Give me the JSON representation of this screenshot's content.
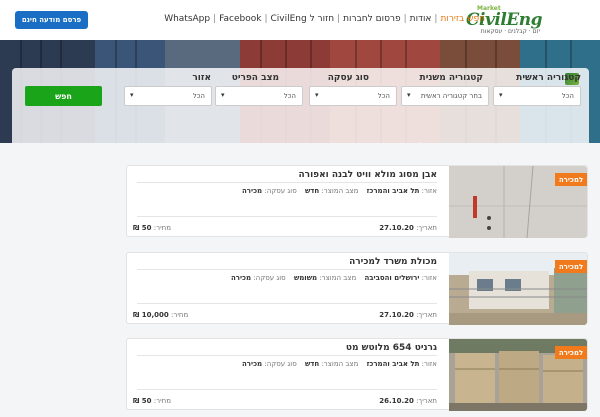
{
  "header": {
    "logo_market": "Market",
    "logo_brand": "CivilEng",
    "logo_tagline": "יזם · קבלנים · עסקאות",
    "nav": [
      "חפש בזירות",
      "אודות",
      "פרסום לחברות",
      "חזור ל CivilEng",
      "Facebook",
      "WhatsApp"
    ],
    "post_button": "פרסם מודעה חינם"
  },
  "search": {
    "fields": [
      {
        "label": "קטגוריה ראשית",
        "value": "הכל"
      },
      {
        "label": "קטגוריה משנית",
        "value": "בחר קטגוריה ראשית"
      },
      {
        "label": "סוג עסקה",
        "value": "הכל"
      },
      {
        "label": "מצב הפריט",
        "value": "הכל"
      },
      {
        "label": "אזור",
        "value": "הכל"
      }
    ],
    "search_button": "חפש"
  },
  "listings": [
    {
      "badge": "למכירה",
      "title": "אבן מסוג מולא וויט לבנה ואפורה",
      "area_label": "אזור:",
      "area": "תל אביב והמרכז",
      "condition_label": "מצב המוצר:",
      "condition": "חדש",
      "deal_label": "סוג עסקה:",
      "deal": "מכירה",
      "date_label": "תאריך:",
      "date": "27.10.20",
      "price_label": "מחיר:",
      "price": "50 ₪"
    },
    {
      "badge": "למכירה",
      "title": "מכולת משרד למכירה",
      "area_label": "אזור:",
      "area": "ירושלים והסביבה",
      "condition_label": "מצב המוצר:",
      "condition": "משומש",
      "deal_label": "סוג עסקה:",
      "deal": "מכירה",
      "date_label": "תאריך:",
      "date": "27.10.20",
      "price_label": "מחיר:",
      "price": "10,000 ₪"
    },
    {
      "badge": "למכירה",
      "title": "גרניט 654 מלוטש מט",
      "area_label": "אזור:",
      "area": "תל אביב והמרכז",
      "condition_label": "מצב המוצר:",
      "condition": "חדש",
      "deal_label": "סוג עסקה:",
      "deal": "מכירה",
      "date_label": "תאריך:",
      "date": "26.10.20",
      "price_label": "מחיר:",
      "price": "50 ₪"
    }
  ],
  "colors": {
    "brand_green": "#2e7d32",
    "accent_orange": "#f07a1c",
    "post_blue": "#1a6fc4",
    "search_green": "#19a41a"
  }
}
